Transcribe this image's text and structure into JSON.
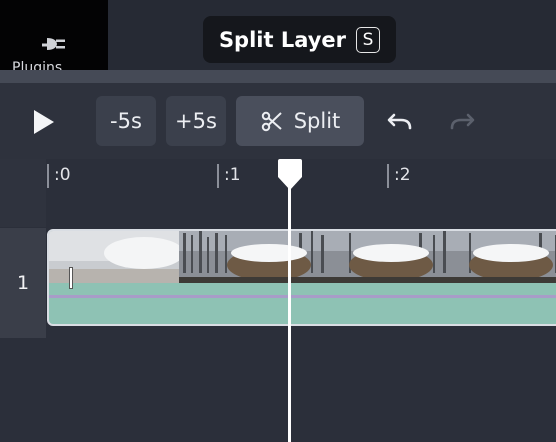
{
  "sidebar": {
    "plugins_label": "Plugins",
    "icon": "plug-icon"
  },
  "tooltip": {
    "text": "Split Layer",
    "shortcut": "S"
  },
  "toolbar": {
    "play_icon": "play-icon",
    "minus5_label": "-5s",
    "plus5_label": "+5s",
    "split_label": "Split",
    "split_icon": "scissors-icon",
    "undo_icon": "undo-icon",
    "redo_icon": "redo-icon",
    "redo_enabled": false
  },
  "timeline": {
    "ruler": [
      ":0",
      ":1",
      ":2"
    ],
    "tracks": [
      {
        "number": "1"
      }
    ]
  },
  "colors": {
    "background": "#2b2f3a",
    "tooltip_bg": "#15171c",
    "button_bg": "#3b404c",
    "split_button_bg": "#4a4f5c",
    "clip_audio": "#8ec2b4",
    "waveform_line": "#a89cc8",
    "playhead": "#ffffff"
  }
}
